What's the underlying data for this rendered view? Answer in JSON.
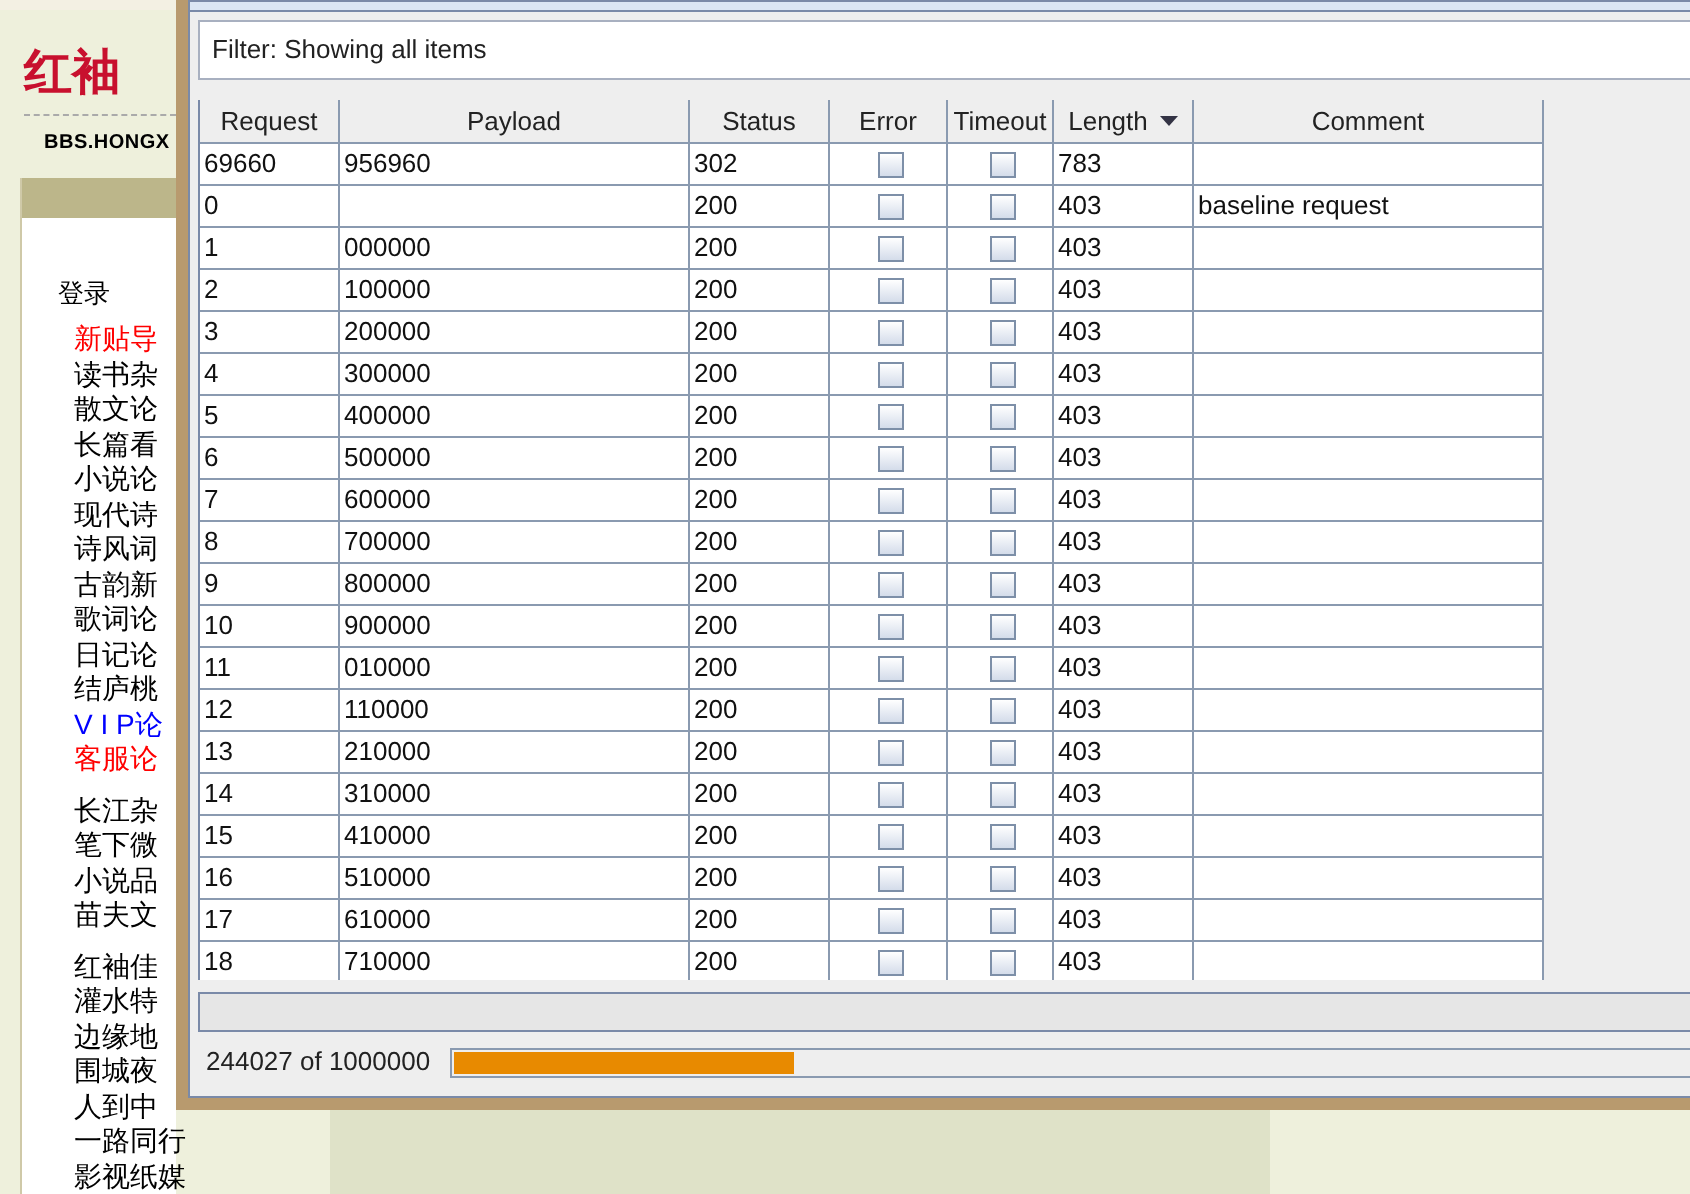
{
  "background_page": {
    "logo": "红袖",
    "site_url": "BBS.HONGX",
    "login_link": "登录",
    "forum_links": [
      {
        "label": "新贴导",
        "color": "#ff0000"
      },
      {
        "label": "读书杂",
        "color": "#000000"
      },
      {
        "label": "散文论",
        "color": "#000000"
      },
      {
        "label": "长篇看",
        "color": "#000000"
      },
      {
        "label": "小说论",
        "color": "#000000"
      },
      {
        "label": "现代诗",
        "color": "#000000"
      },
      {
        "label": "诗风词",
        "color": "#000000"
      },
      {
        "label": "古韵新",
        "color": "#000000"
      },
      {
        "label": "歌词论",
        "color": "#000000"
      },
      {
        "label": "日记论",
        "color": "#000000"
      },
      {
        "label": "结庐桃",
        "color": "#000000"
      },
      {
        "label": "V I P论",
        "color": "#0000ff"
      },
      {
        "label": "客服论",
        "color": "#ff0000"
      }
    ],
    "forum_groups": [
      [
        "长江杂",
        "笔下微",
        "小说品",
        "苗夫文"
      ],
      [
        "红袖佳",
        "灌水特",
        "边缘地",
        "围城夜",
        "人到中",
        "一路同行",
        "影视纸媒"
      ]
    ]
  },
  "intruder_window": {
    "filter": "Filter: Showing all items",
    "table": {
      "columns": [
        {
          "label": "Request",
          "sorted": false
        },
        {
          "label": "Payload",
          "sorted": false
        },
        {
          "label": "Status",
          "sorted": false
        },
        {
          "label": "Error",
          "sorted": false
        },
        {
          "label": "Timeout",
          "sorted": false
        },
        {
          "label": "Length",
          "sorted": true
        },
        {
          "label": "Comment",
          "sorted": false
        }
      ],
      "rows": [
        {
          "request": "69660",
          "payload": "956960",
          "status": "302",
          "error": false,
          "timeout": false,
          "length": "783"
        },
        {
          "request": "0",
          "status": "200",
          "error": false,
          "timeout": false,
          "length": "403",
          "comment": "baseline request"
        },
        {
          "request": "1",
          "payload": "000000",
          "status": "200",
          "error": false,
          "timeout": false,
          "length": "403"
        },
        {
          "request": "2",
          "payload": "100000",
          "status": "200",
          "error": false,
          "timeout": false,
          "length": "403"
        },
        {
          "request": "3",
          "payload": "200000",
          "status": "200",
          "error": false,
          "timeout": false,
          "length": "403"
        },
        {
          "request": "4",
          "payload": "300000",
          "status": "200",
          "error": false,
          "timeout": false,
          "length": "403"
        },
        {
          "request": "5",
          "payload": "400000",
          "status": "200",
          "error": false,
          "timeout": false,
          "length": "403"
        },
        {
          "request": "6",
          "payload": "500000",
          "status": "200",
          "error": false,
          "timeout": false,
          "length": "403"
        },
        {
          "request": "7",
          "payload": "600000",
          "status": "200",
          "error": false,
          "timeout": false,
          "length": "403"
        },
        {
          "request": "8",
          "payload": "700000",
          "status": "200",
          "error": false,
          "timeout": false,
          "length": "403"
        },
        {
          "request": "9",
          "payload": "800000",
          "status": "200",
          "error": false,
          "timeout": false,
          "length": "403"
        },
        {
          "request": "10",
          "payload": "900000",
          "status": "200",
          "error": false,
          "timeout": false,
          "length": "403"
        },
        {
          "request": "11",
          "payload": "010000",
          "status": "200",
          "error": false,
          "timeout": false,
          "length": "403"
        },
        {
          "request": "12",
          "payload": "110000",
          "status": "200",
          "error": false,
          "timeout": false,
          "length": "403"
        },
        {
          "request": "13",
          "payload": "210000",
          "status": "200",
          "error": false,
          "timeout": false,
          "length": "403"
        },
        {
          "request": "14",
          "payload": "310000",
          "status": "200",
          "error": false,
          "timeout": false,
          "length": "403"
        },
        {
          "request": "15",
          "payload": "410000",
          "status": "200",
          "error": false,
          "timeout": false,
          "length": "403"
        },
        {
          "request": "16",
          "payload": "510000",
          "status": "200",
          "error": false,
          "timeout": false,
          "length": "403"
        },
        {
          "request": "17",
          "payload": "610000",
          "status": "200",
          "error": false,
          "timeout": false,
          "length": "403"
        },
        {
          "request": "18",
          "payload": "710000",
          "status": "200",
          "error": false,
          "timeout": false,
          "length": "403"
        }
      ]
    },
    "progress": {
      "text": "244027 of 1000000",
      "level": 0.27
    }
  }
}
